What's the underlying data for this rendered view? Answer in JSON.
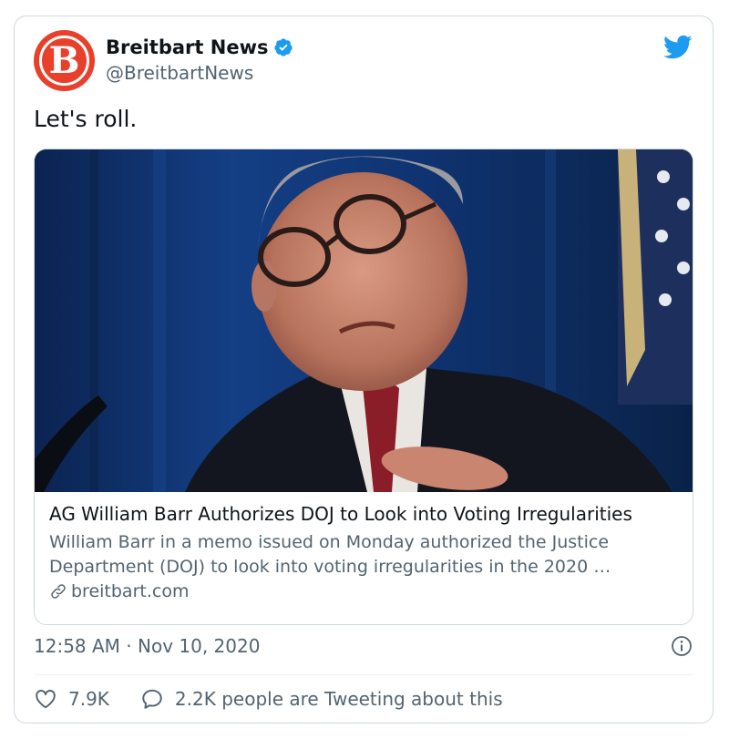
{
  "author": {
    "display_name": "Breitbart News",
    "handle": "@BreitbartNews",
    "avatar_letter": "B",
    "verified": true
  },
  "tweet": {
    "text": "Let's roll."
  },
  "link_card": {
    "title": "AG William Barr Authorizes DOJ to Look into Voting Irregularities",
    "description_line1": "William Barr in a memo issued on Monday authorized the Justice",
    "description_line2": "Department (DOJ) to look into voting irregularities in the 2020 …",
    "domain": "breitbart.com"
  },
  "meta": {
    "timestamp": "12:58 AM · Nov 10, 2020"
  },
  "actions": {
    "likes": "7.9K",
    "conversation": "2.2K people are Tweeting about this"
  },
  "icons": {
    "verified": "verified-badge-icon",
    "brand": "twitter-bird-icon",
    "info": "info-icon",
    "like": "heart-icon",
    "reply": "speech-bubble-icon",
    "link": "link-icon"
  },
  "colors": {
    "brand_blue": "#1d9bf0",
    "avatar_red": "#e8402a",
    "secondary_text": "#536471"
  }
}
